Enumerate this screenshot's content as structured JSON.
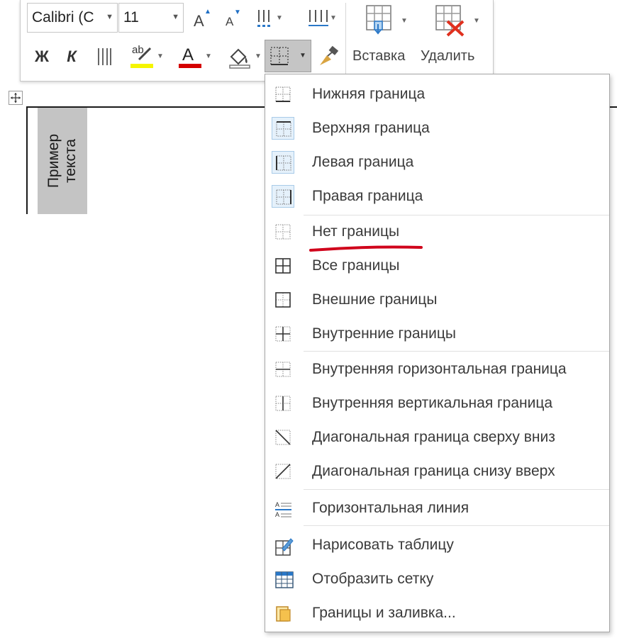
{
  "toolbar": {
    "font_name": "Calibri (C",
    "font_size": "11",
    "grow_font_icon": "grow-font-icon",
    "shrink_font_icon": "shrink-font-icon",
    "bold_label": "Ж",
    "italic_label": "К",
    "font_letter": "A",
    "highlight_letters": "ab",
    "highlight_color": "#f5f500",
    "font_color": "#d40000",
    "insert_label": "Вставка",
    "delete_label": "Удалить"
  },
  "document": {
    "cell_text_line1": "Пример",
    "cell_text_line2": "текста"
  },
  "menu": {
    "items": [
      {
        "label": "Нижняя граница",
        "icon": "bottom-border-icon",
        "checked": false
      },
      {
        "label": "Верхняя граница",
        "icon": "top-border-icon",
        "checked": true
      },
      {
        "label": "Левая граница",
        "icon": "left-border-icon",
        "checked": true
      },
      {
        "label": "Правая граница",
        "icon": "right-border-icon",
        "checked": true
      },
      {
        "label": "Нет границы",
        "icon": "no-border-icon",
        "checked": false
      },
      {
        "label": "Все границы",
        "icon": "all-borders-icon",
        "checked": false
      },
      {
        "label": "Внешние границы",
        "icon": "outside-borders-icon",
        "checked": false
      },
      {
        "label": "Внутренние границы",
        "icon": "inside-borders-icon",
        "checked": false
      },
      {
        "label": "Внутренняя горизонтальная граница",
        "icon": "inside-horizontal-border-icon",
        "checked": false
      },
      {
        "label": "Внутренняя вертикальная граница",
        "icon": "inside-vertical-border-icon",
        "checked": false
      },
      {
        "label": "Диагональная граница сверху вниз",
        "icon": "diagonal-down-border-icon",
        "checked": false
      },
      {
        "label": "Диагональная граница снизу вверх",
        "icon": "diagonal-up-border-icon",
        "checked": false
      },
      {
        "label": "Горизонтальная линия",
        "icon": "horizontal-line-icon",
        "checked": false
      },
      {
        "label": "Нарисовать таблицу",
        "icon": "draw-table-icon",
        "checked": false
      },
      {
        "label": "Отобразить сетку",
        "icon": "view-gridlines-icon",
        "checked": false
      },
      {
        "label": "Границы и заливка...",
        "icon": "borders-shading-icon",
        "checked": false
      }
    ]
  },
  "colors": {
    "annotation_underline": "#d0021b",
    "checked_bg": "#e5f1fb",
    "checked_border": "#a9cbe8"
  }
}
